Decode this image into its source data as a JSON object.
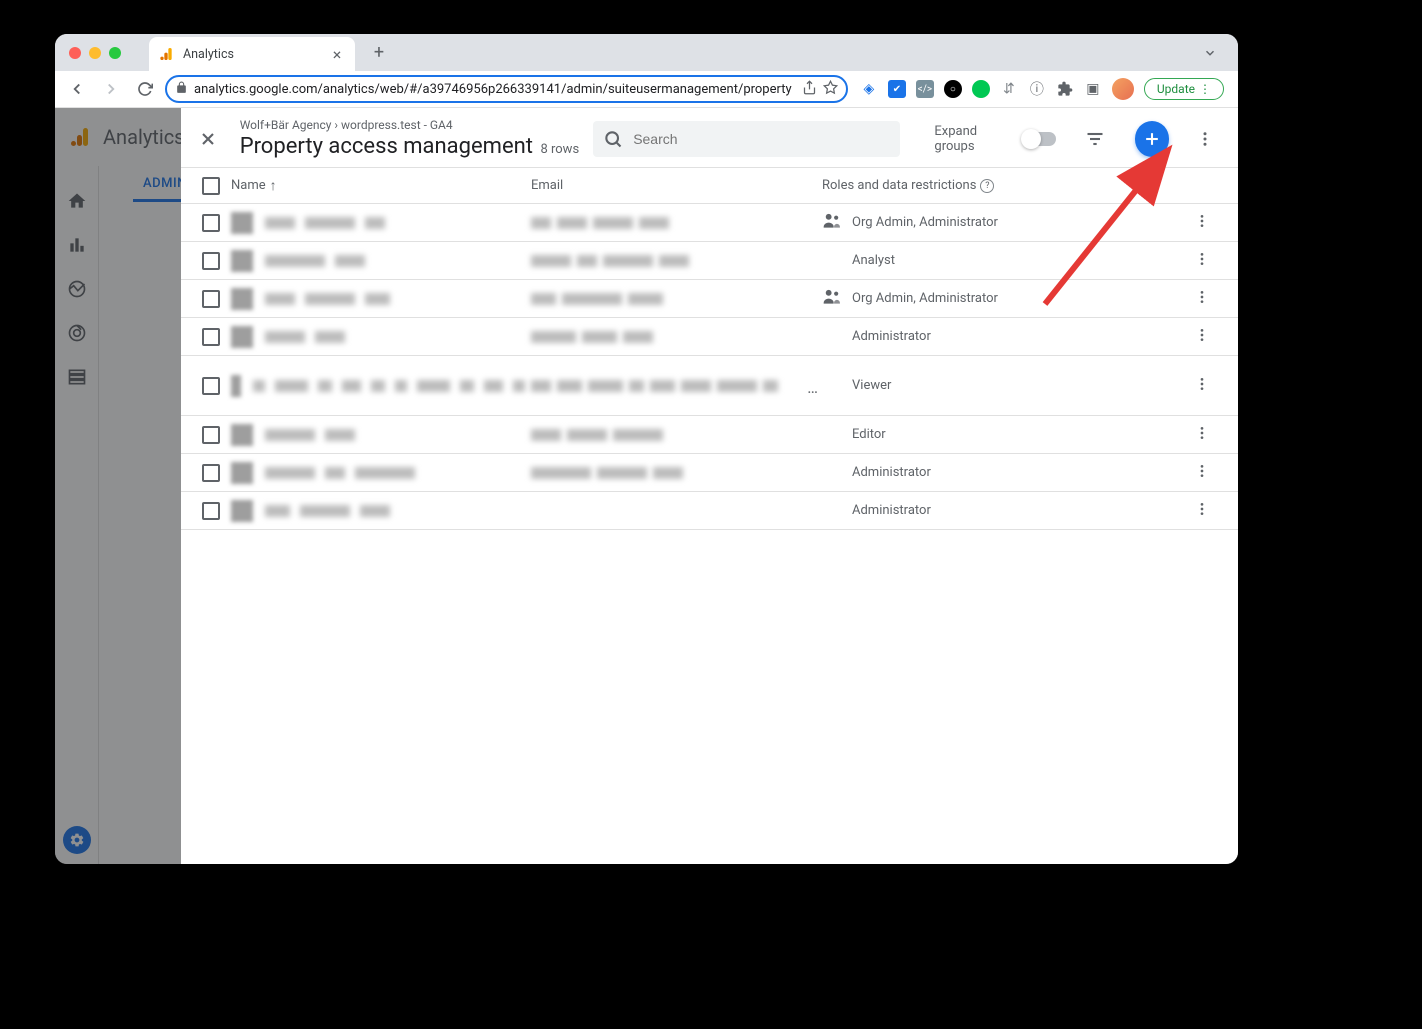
{
  "browser": {
    "tab_title": "Analytics",
    "url": "analytics.google.com/analytics/web/#/a39746956p266339141/admin/suiteusermanagement/property",
    "update_label": "Update"
  },
  "ga": {
    "product_name": "Analytics",
    "admin_tab": "ADMIN"
  },
  "panel": {
    "breadcrumb": "Wolf+Bär Agency › wordpress.test - GA4",
    "title": "Property access management",
    "row_count": "8 rows",
    "search_placeholder": "Search",
    "expand_groups_label": "Expand groups"
  },
  "columns": {
    "name": "Name",
    "email": "Email",
    "roles": "Roles and data restrictions"
  },
  "rows": [
    {
      "role": "Org Admin, Administrator",
      "org_icon": true
    },
    {
      "role": "Analyst",
      "org_icon": false
    },
    {
      "role": "Org Admin, Administrator",
      "org_icon": true
    },
    {
      "role": "Administrator",
      "org_icon": false
    },
    {
      "role": "Viewer",
      "org_icon": false,
      "truncated": true,
      "tall": true
    },
    {
      "role": "Editor",
      "org_icon": false
    },
    {
      "role": "Administrator",
      "org_icon": false
    },
    {
      "role": "Administrator",
      "org_icon": false
    }
  ]
}
